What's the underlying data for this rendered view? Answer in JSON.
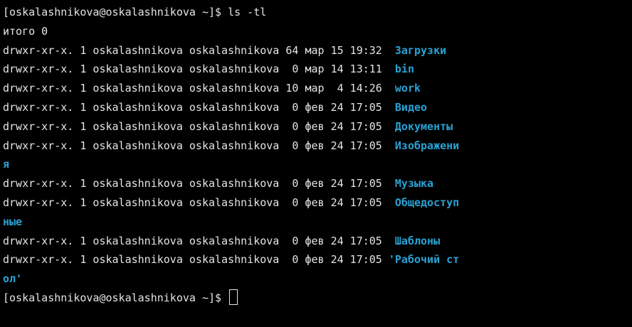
{
  "terminal": {
    "prompt": "[oskalashnikova@oskalashnikova ~]$ ",
    "command": "ls -tl",
    "total": "итого 0",
    "entries": [
      {
        "meta": "drwxr-xr-x. 1 oskalashnikova oskalashnikova 64 мар 15 19:32  ",
        "name": "Загрузки"
      },
      {
        "meta": "drwxr-xr-x. 1 oskalashnikova oskalashnikova  0 мар 14 13:11  ",
        "name": "bin"
      },
      {
        "meta": "drwxr-xr-x. 1 oskalashnikova oskalashnikova 10 мар  4 14:26  ",
        "name": "work"
      },
      {
        "meta": "drwxr-xr-x. 1 oskalashnikova oskalashnikova  0 фев 24 17:05  ",
        "name": "Видео"
      },
      {
        "meta": "drwxr-xr-x. 1 oskalashnikova oskalashnikova  0 фев 24 17:05  ",
        "name": "Документы"
      },
      {
        "meta": "drwxr-xr-x. 1 oskalashnikova oskalashnikova  0 фев 24 17:05  ",
        "name": "Изображени",
        "wrap": "я"
      },
      {
        "meta": "drwxr-xr-x. 1 oskalashnikova oskalashnikova  0 фев 24 17:05  ",
        "name": "Музыка"
      },
      {
        "meta": "drwxr-xr-x. 1 oskalashnikova oskalashnikova  0 фев 24 17:05  ",
        "name": "Общедоступ",
        "wrap": "ные"
      },
      {
        "meta": "drwxr-xr-x. 1 oskalashnikova oskalashnikova  0 фев 24 17:05  ",
        "name": "Шаблоны"
      },
      {
        "meta": "drwxr-xr-x. 1 oskalashnikova oskalashnikova  0 фев 24 17:05 ",
        "name": "'Рабочий ст",
        "wrap": "ол'"
      }
    ],
    "final_prompt": "[oskalashnikova@oskalashnikova ~]$ ",
    "colors": {
      "background": "#000000",
      "text": "#e4e4e4",
      "directory": "#2aa1d3"
    }
  }
}
